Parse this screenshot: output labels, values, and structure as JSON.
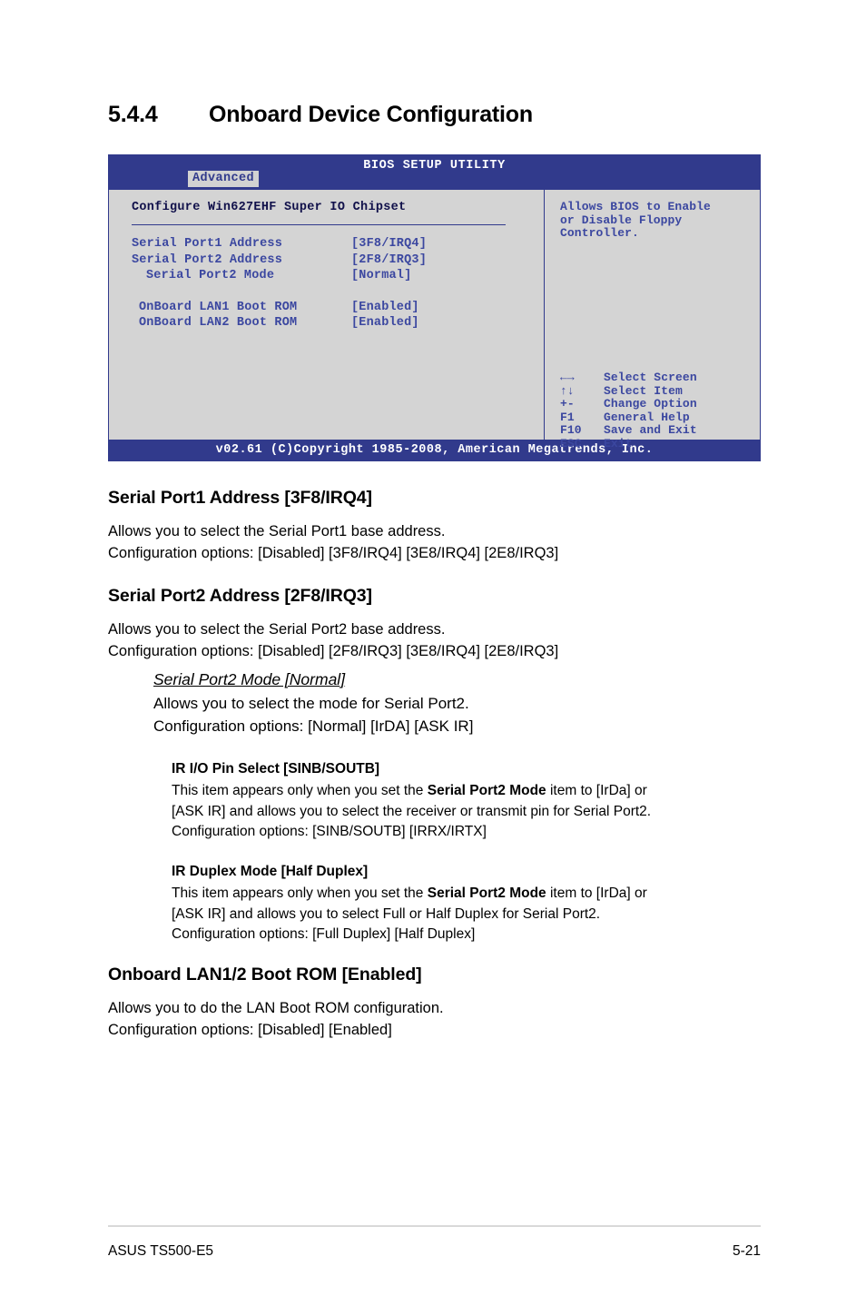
{
  "section": {
    "number": "5.4.4",
    "title": "Onboard Device Configuration"
  },
  "bios": {
    "title": "BIOS SETUP UTILITY",
    "active_tab": "Advanced",
    "config_title": "Configure Win627EHF Super IO Chipset",
    "items": [
      {
        "label": "Serial Port1 Address",
        "value": "[3F8/IRQ4]"
      },
      {
        "label": "Serial Port2 Address",
        "value": "[2F8/IRQ3]"
      },
      {
        "label": "Serial Port2 Mode",
        "value": "[Normal]"
      },
      {
        "label": "OnBoard LAN1 Boot ROM",
        "value": "[Enabled]"
      },
      {
        "label": "OnBoard LAN2 Boot ROM",
        "value": "[Enabled]"
      }
    ],
    "help_text": "Allows BIOS to Enable\nor Disable Floppy\nController.",
    "legend": [
      {
        "key": "←→",
        "action": "Select Screen"
      },
      {
        "key": "↑↓",
        "action": "Select Item"
      },
      {
        "key": "+-",
        "action": "Change Option"
      },
      {
        "key": "F1",
        "action": "General Help"
      },
      {
        "key": "F10",
        "action": "Save and Exit"
      },
      {
        "key": "ESC",
        "action": "Exit"
      }
    ],
    "footer": "v02.61 (C)Copyright 1985-2008, American Megatrends, Inc."
  },
  "sections": {
    "serial_port1": {
      "heading": "Serial Port1 Address [3F8/IRQ4]",
      "line1": "Allows you to select the Serial Port1 base address.",
      "line2": "Configuration options: [Disabled] [3F8/IRQ4] [3E8/IRQ4] [2E8/IRQ3]"
    },
    "serial_port2": {
      "heading": "Serial Port2 Address [2F8/IRQ3]",
      "line1": "Allows you to select the Serial Port2 base address.",
      "line2": "Configuration options: [Disabled] [2F8/IRQ3] [3E8/IRQ4] [2E8/IRQ3]"
    },
    "serial_port2_mode": {
      "heading": "Serial Port2 Mode [Normal]",
      "line1": "Allows you to select the mode for Serial Port2.",
      "line2": "Configuration options: [Normal] [IrDA] [ASK IR]"
    },
    "ir_io_pin": {
      "heading": "IR I/O Pin Select [SINB/SOUTB]",
      "line1_a": "This item appears only when you set the ",
      "line1_b": "Serial Port2 Mode",
      "line1_c": " item to [IrDa] or",
      "line2": "[ASK IR] and allows you to select the receiver or transmit pin for Serial Port2.",
      "line3": "Configuration options: [SINB/SOUTB] [IRRX/IRTX]"
    },
    "ir_duplex": {
      "heading": "IR Duplex Mode [Half Duplex]",
      "line1_a": "This item appears only when you set the ",
      "line1_b": "Serial Port2 Mode",
      "line1_c": " item to [IrDa] or",
      "line2": "[ASK IR] and allows you to select Full or Half Duplex for Serial Port2.",
      "line3": "Configuration options: [Full Duplex] [Half Duplex]"
    },
    "onboard_lan": {
      "heading": "Onboard LAN1/2 Boot ROM [Enabled]",
      "line1": "Allows you to do the LAN Boot ROM configuration.",
      "line2": "Configuration options: [Disabled] [Enabled]"
    }
  },
  "page_footer": {
    "product": "ASUS TS500-E5",
    "page_number": "5-21"
  }
}
